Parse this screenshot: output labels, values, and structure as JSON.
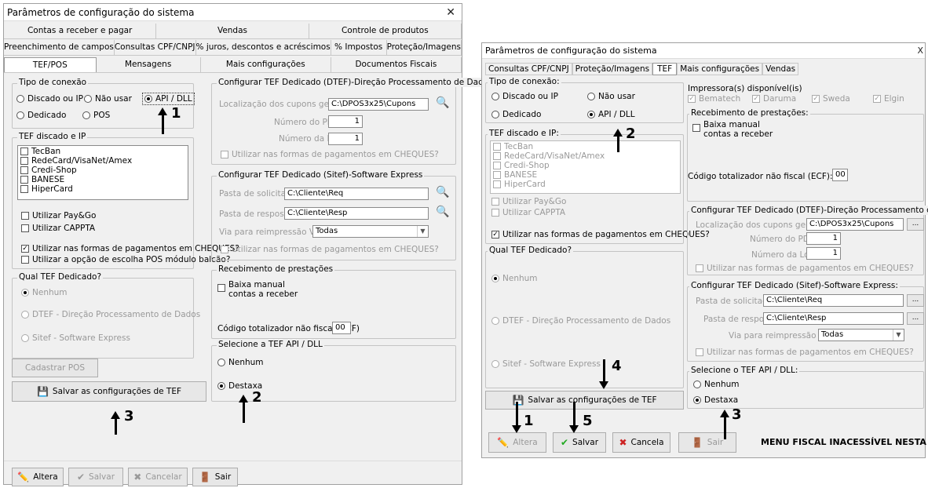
{
  "left": {
    "title": "Parâmetros de configuração do sistema",
    "close": "✕",
    "tabs_row1": [
      "Contas a receber e pagar",
      "Vendas",
      "Controle de produtos"
    ],
    "tabs_row2": [
      "Preenchimento de campos",
      "Consultas CPF/CNPJ",
      "% juros, descontos e acréscimos",
      "% Impostos",
      "Proteção/Imagens"
    ],
    "tabs_row3": [
      "TEF/POS",
      "Mensagens",
      "Mais configurações",
      "Documentos Fiscais"
    ],
    "conn": {
      "title": "Tipo de conexão",
      "discado": "Discado ou IP",
      "naousar": "Não usar",
      "api": "API / DLL",
      "dedicado": "Dedicado",
      "pos": "POS"
    },
    "tefip": {
      "title": "TEF discado e IP",
      "items": [
        "TecBan",
        "RedeCard/VisaNet/Amex",
        "Credi-Shop",
        "BANESE",
        "HiperCard"
      ],
      "paygo": "Utilizar Pay&Go",
      "cappta": "Utilizar CAPPTA",
      "cheques": "Utilizar nas formas de pagamentos em CHEQUES?",
      "pos_balcao": "Utilizar a opção de escolha POS módulo balcão?"
    },
    "qual": {
      "title": "Qual TEF Dedicado?",
      "nenhum": "Nenhum",
      "dtef": "DTEF - Direção Processamento de Dados",
      "sitef": "Sitef - Software Express"
    },
    "cadastrar_pos": "Cadastrar POS",
    "salvar_tef": "Salvar as configurações de TEF",
    "dtef": {
      "title": "Configurar TEF Dedicado (DTEF)-Direção Processamento de Dados",
      "loc_label": "Localização dos cupons gerados",
      "loc_val": "C:\\DPOS3x25\\Cupons",
      "pdv_label": "Número do PDV",
      "pdv_val": "1",
      "loja_label": "Número da loja",
      "loja_val": "1",
      "cheques": "Utilizar nas formas de pagamentos em CHEQUES?"
    },
    "sitef": {
      "title": "Configurar TEF Dedicado (Sitef)-Software Express",
      "sol_label": "Pasta de solicitação",
      "sol_val": "C:\\Cliente\\Req",
      "resp_label": "Pasta de resposta",
      "resp_val": "C:\\Cliente\\Resp",
      "via_label": "Via para reimpressão VISA",
      "via_val": "Todas",
      "cheques": "Utilizar nas formas de pagamentos em CHEQUES?"
    },
    "prest": {
      "title": "Recebimento de prestações",
      "baixa": "Baixa manual contas a receber",
      "codigo_label": "Código totalizador não fiscal (ECF)",
      "codigo_val": "00"
    },
    "apidll": {
      "title": "Selecione a TEF API / DLL",
      "nenhum": "Nenhum",
      "destaxa": "Destaxa"
    },
    "bottom": {
      "altera": "Altera",
      "salvar": "Salvar",
      "cancelar": "Cancelar",
      "sair": "Sair"
    },
    "ann": [
      "1",
      "2",
      "3"
    ]
  },
  "right": {
    "title": "Parâmetros de configuração do sistema",
    "close": "X",
    "tabs": [
      "Consultas CPF/CNPJ",
      "Proteção/Imagens",
      "TEF",
      "Mais configurações",
      "Vendas"
    ],
    "conn": {
      "title": "Tipo de conexão:",
      "discado": "Discado ou IP",
      "naousar": "Não usar",
      "dedicado": "Dedicado",
      "api": "API / DLL"
    },
    "tefip": {
      "title": "TEF discado e IP:",
      "items": [
        "TecBan",
        "RedeCard/VisaNet/Amex",
        "Credi-Shop",
        "BANESE",
        "HiperCard"
      ],
      "paygo": "Utilizar Pay&Go",
      "cappta": "Utilizar CAPPTA",
      "cheques": "Utilizar nas formas de pagamentos em CHEQUES?"
    },
    "qual": {
      "title": "Qual TEF Dedicado?",
      "nenhum": "Nenhum",
      "dtef": "DTEF - Direção Processamento de Dados",
      "sitef": "Sitef - Software Express"
    },
    "salvar_tef": "Salvar as configurações de TEF",
    "impressora": {
      "title": "Impressora(s) disponível(is)",
      "items": [
        "Bematech",
        "Daruma",
        "Sweda",
        "Elgin"
      ]
    },
    "prest": {
      "title": "Recebimento de prestações:",
      "baixa": "Baixa manual contas a receber",
      "codigo_label": "Código totalizador não fiscal (ECF):",
      "codigo_val": "00"
    },
    "dtef": {
      "title": "Configurar TEF Dedicado (DTEF)-Direção Processamento de Dados:",
      "loc_label": "Localização dos cupons gerados:",
      "loc_val": "C:\\DPOS3x25\\Cupons",
      "pdv_label": "Número do PDV:",
      "pdv_val": "1",
      "loja_label": "Número da Loja:",
      "loja_val": "1",
      "cheques": "Utilizar nas formas de pagamentos em CHEQUES?"
    },
    "sitef": {
      "title": "Configurar TEF Dedicado (Sitef)-Software Express:",
      "sol_label": "Pasta de solicitação:",
      "sol_val": "C:\\Cliente\\Req",
      "resp_label": "Pasta de resposta:",
      "resp_val": "C:\\Cliente\\Resp",
      "via_label": "Via para reimpressão VISA:",
      "via_val": "Todas",
      "cheques": "Utilizar nas formas de pagamentos em CHEQUES?"
    },
    "apidll": {
      "title": "Selecione o TEF API / DLL:",
      "nenhum": "Nenhum",
      "destaxa": "Destaxa"
    },
    "bottom": {
      "altera": "Altera",
      "salvar": "Salvar",
      "cancela": "Cancela",
      "sair": "Sair",
      "menu_fiscal": "MENU FISCAL INACESSÍVEL NESTA TELA"
    },
    "dots": "...",
    "ann": [
      "1",
      "2",
      "3",
      "4",
      "5"
    ]
  }
}
